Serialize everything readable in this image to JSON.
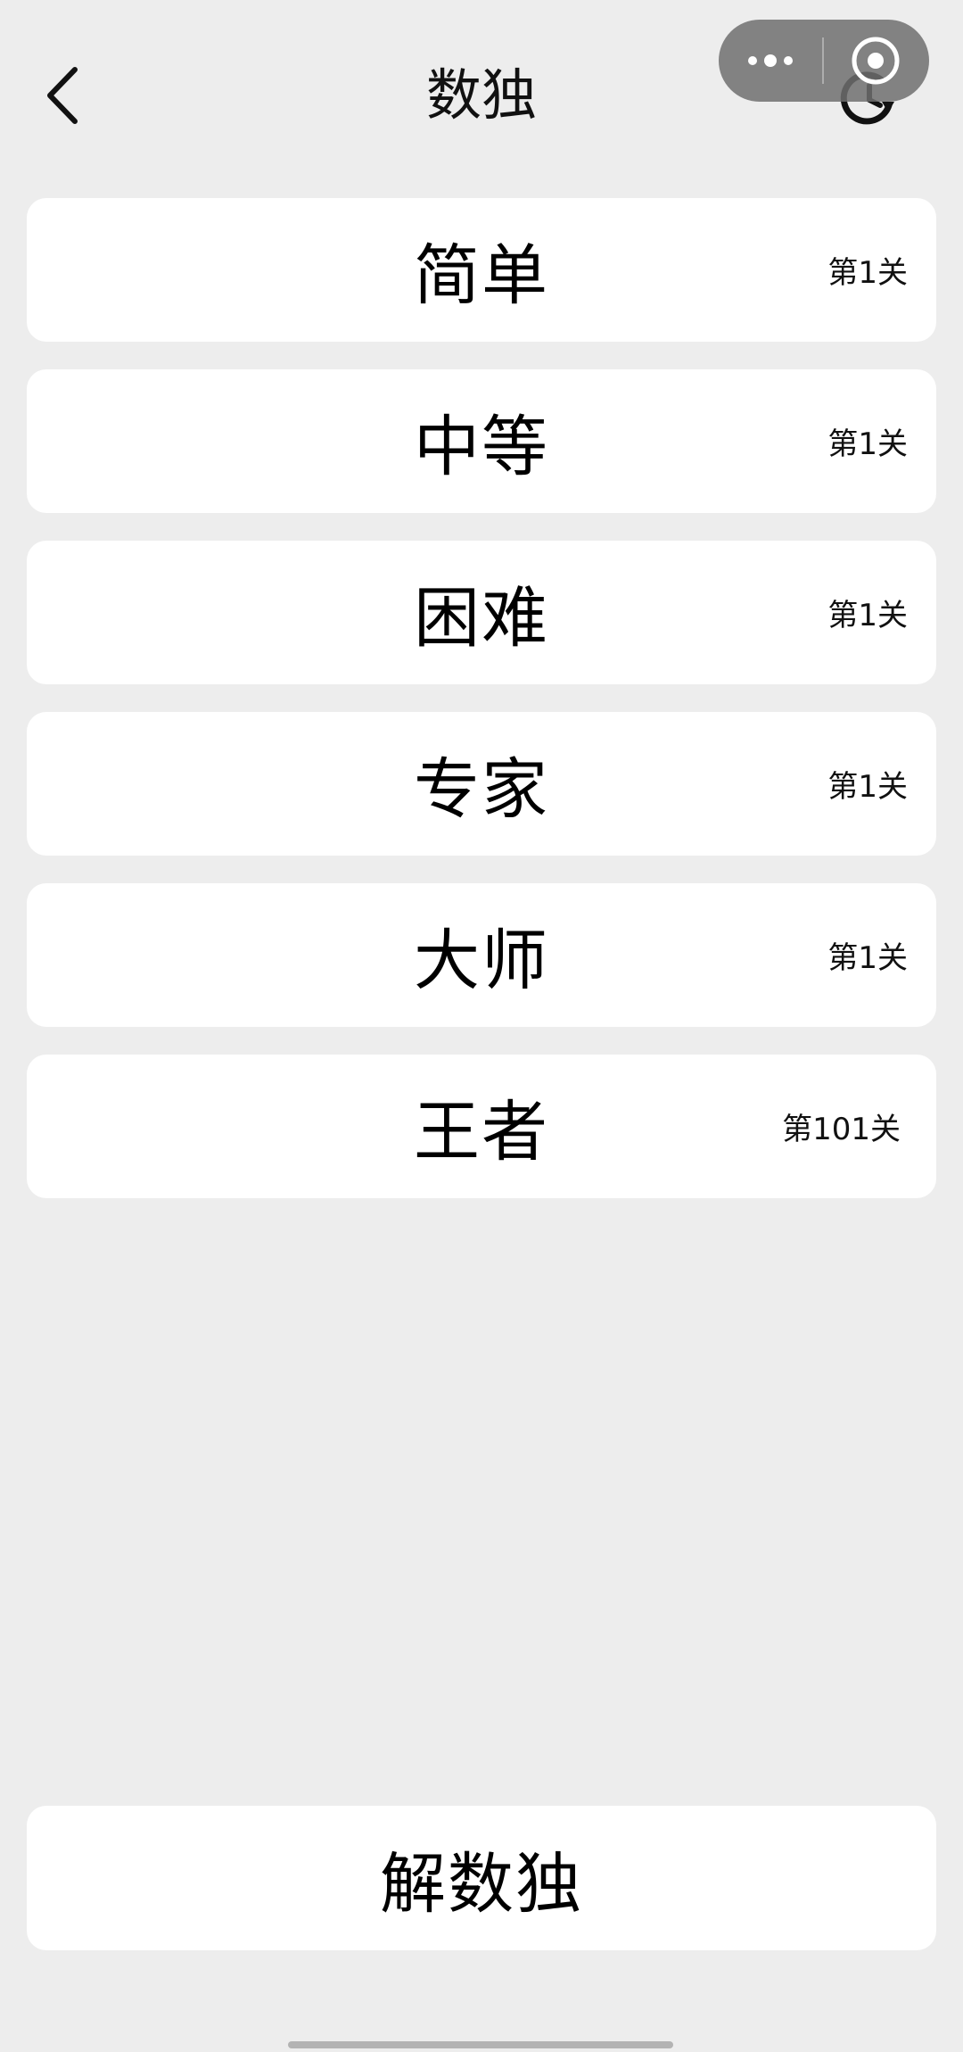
{
  "header": {
    "title": "数独",
    "back_icon": "chevron-left-icon",
    "history_icon": "history-icon"
  },
  "capsule": {
    "more_icon": "more-dots-icon",
    "close_icon": "target-close-icon"
  },
  "levels": [
    {
      "name": "简单",
      "progress": "第1关"
    },
    {
      "name": "中等",
      "progress": "第1关"
    },
    {
      "name": "困难",
      "progress": "第1关"
    },
    {
      "name": "专家",
      "progress": "第1关"
    },
    {
      "name": "大师",
      "progress": "第1关"
    },
    {
      "name": "王者",
      "progress": "第101关"
    }
  ],
  "solve_button": {
    "label": "解数独"
  },
  "colors": {
    "background": "#ededed",
    "card": "#ffffff",
    "capsule": "#6e6e6e"
  }
}
